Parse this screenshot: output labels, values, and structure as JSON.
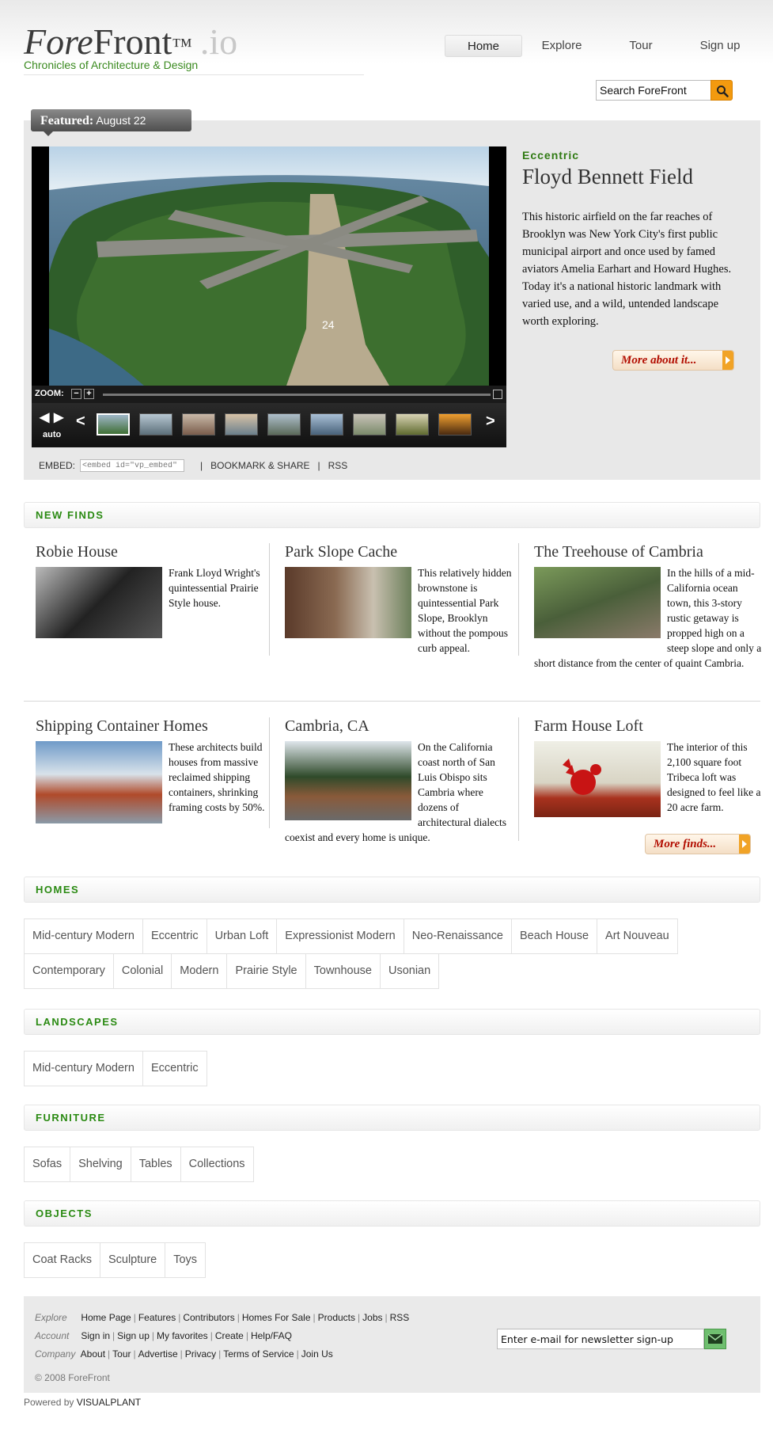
{
  "header": {
    "logo_fore": "Fore",
    "logo_front": "Front",
    "logo_tm": "™",
    "logo_io": ".io",
    "tagline": "Chronicles of Architecture & Design",
    "nav": [
      "Home",
      "Explore",
      "Tour",
      "Sign up"
    ],
    "search_placeholder": "Search ForeFront"
  },
  "featured": {
    "tab_bold": "Featured:",
    "tab_date": "August 22",
    "category": "Eccentric",
    "title": "Floyd Bennett Field",
    "description": "This historic airfield on the far reaches of Brooklyn was New York City's first public municipal airport and once used by famed aviators Amelia Earhart and Howard Hughes. Today it's a national historic landmark with varied use, and a wild, untended landscape worth exploring.",
    "more_label": "More about it...",
    "zoom_label": "ZOOM:",
    "zoom_minus": "−",
    "zoom_plus": "+",
    "auto_label": "auto",
    "embed_label": "EMBED:",
    "embed_value": "<embed id=\"vp_embed\"",
    "bookmark": "BOOKMARK & SHARE",
    "rss": "RSS",
    "runway_number": "24"
  },
  "new_finds": {
    "heading": "NEW FINDS",
    "items": [
      {
        "title": "Robie House",
        "text": "Frank Lloyd Wright's quintessential Prairie Style house."
      },
      {
        "title": "Park Slope Cache",
        "text": "This relatively hidden brownstone is quintessential Park Slope, Brooklyn without the pompous curb appeal."
      },
      {
        "title": "The Treehouse of Cambria",
        "text": "In the hills of a mid-California ocean town, this 3-story rustic getaway is propped high on a steep slope and only a short distance from the center of quaint Cambria."
      },
      {
        "title": "Shipping Container Homes",
        "text": "These architects build houses from massive reclaimed shipping containers, shrinking framing costs by 50%."
      },
      {
        "title": "Cambria, CA",
        "text": "On the California coast north of San Luis Obispo sits Cambria where dozens of architectural dialects coexist and every home is unique."
      },
      {
        "title": "Farm House Loft",
        "text": "The interior of this 2,100 square foot Tribeca loft was designed to feel like a 20 acre farm."
      }
    ],
    "more_label": "More finds..."
  },
  "homes": {
    "heading": "HOMES",
    "tags": [
      "Mid-century Modern",
      "Eccentric",
      "Urban Loft",
      "Expressionist Modern",
      "Neo-Renaissance",
      "Beach House",
      "Art Nouveau",
      "Contemporary",
      "Colonial",
      "Modern",
      "Prairie Style",
      "Townhouse",
      "Usonian"
    ]
  },
  "landscapes": {
    "heading": "LANDSCAPES",
    "tags": [
      "Mid-century Modern",
      "Eccentric"
    ]
  },
  "furniture": {
    "heading": "FURNITURE",
    "tags": [
      "Sofas",
      "Shelving",
      "Tables",
      "Collections"
    ]
  },
  "objects": {
    "heading": "OBJECTS",
    "tags": [
      "Coat Racks",
      "Sculpture",
      "Toys"
    ]
  },
  "footer": {
    "explore_label": "Explore",
    "explore_links": [
      "Home Page",
      "Features",
      "Contributors",
      "Homes For Sale",
      "Products",
      "Jobs",
      "RSS"
    ],
    "account_label": "Account",
    "account_links": [
      "Sign in",
      "Sign up",
      "My favorites",
      "Create",
      "Help/FAQ"
    ],
    "company_label": "Company",
    "company_links": [
      "About",
      "Tour",
      "Advertise",
      "Privacy",
      "Terms of Service",
      "Join Us"
    ],
    "newsletter_placeholder": "Enter e-mail for newsletter sign-up",
    "copyright": "© 2008 ForeFront",
    "powered_by": "Powered by",
    "powered_name": "VISUALPLANT"
  },
  "colors": {
    "accent_green": "#2a8a12",
    "search_orange": "#f39a0f",
    "more_red": "#b20d00"
  }
}
